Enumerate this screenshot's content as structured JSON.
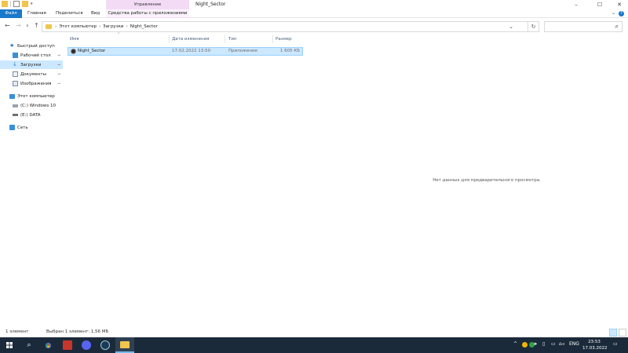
{
  "window": {
    "title": "Night_Sector",
    "context_tab_header": "Управление",
    "controls": {
      "minimize": "–",
      "maximize": "☐",
      "close": "✕"
    }
  },
  "ribbon": {
    "tabs": [
      "Файл",
      "Главная",
      "Поделиться",
      "Вид"
    ],
    "context_tab": "Средства работы с приложениями",
    "help": "?",
    "expand": "⌄"
  },
  "address": {
    "crumbs": [
      "Этот компьютер",
      "Загрузки",
      "Night_Sector"
    ],
    "separator": "›",
    "search_placeholder": ""
  },
  "nav_pane": {
    "items": [
      {
        "label": "Быстрый доступ",
        "icon": "star-icon",
        "pinned": false
      },
      {
        "label": "Рабочий стол",
        "icon": "desktop-icon",
        "pinned": true
      },
      {
        "label": "Загрузки",
        "icon": "download-icon",
        "pinned": true,
        "selected": true
      },
      {
        "label": "Документы",
        "icon": "documents-icon",
        "pinned": true
      },
      {
        "label": "Изображения",
        "icon": "pictures-icon",
        "pinned": true
      },
      {
        "label": "Этот компьютер",
        "icon": "computer-icon",
        "pinned": false
      },
      {
        "label": "(C:) Windows 10",
        "icon": "drive-icon",
        "pinned": false
      },
      {
        "label": "(E:) DATA",
        "icon": "drive-icon",
        "pinned": false
      },
      {
        "label": "Сеть",
        "icon": "network-icon",
        "pinned": false
      }
    ],
    "pin_glyph": "📌"
  },
  "file_list": {
    "columns": [
      "Имя",
      "Дата изменения",
      "Тип",
      "Размер"
    ],
    "rows": [
      {
        "name": "Night_Sector",
        "date": "17.02.2022 13:50",
        "type": "Приложение",
        "size": "1 605 КБ"
      }
    ]
  },
  "preview": {
    "message": "Нет данных для предварительного просмотра."
  },
  "status_bar": {
    "count": "1 элемент",
    "selection": "Выбран 1 элемент: 1,56 МБ"
  },
  "taskbar": {
    "apps": [
      "windows-start-icon",
      "search-icon",
      "chrome-icon",
      "app-icon",
      "discord-icon",
      "steam-icon",
      "file-explorer-icon"
    ],
    "tray": {
      "language": "ENG",
      "time": "23:53",
      "date": "17.03.2022",
      "chevron": "^"
    }
  },
  "colors": {
    "accent": "#1979ca",
    "selection": "#cce8ff",
    "context": "#f3dbf6",
    "taskbar": "#1b2a3a"
  }
}
